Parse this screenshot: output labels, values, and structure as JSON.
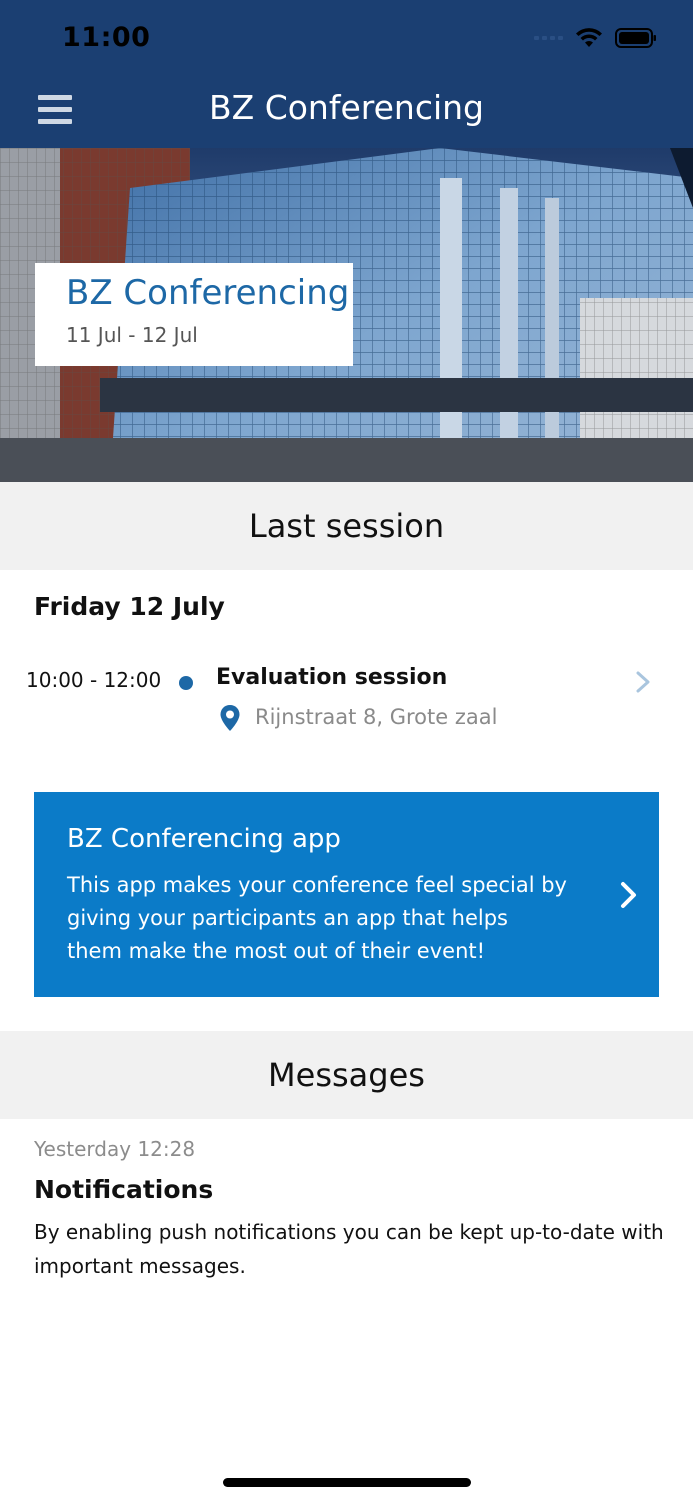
{
  "status_bar": {
    "time": "11:00",
    "icons": [
      "signal-icon",
      "wifi-icon",
      "battery-icon"
    ]
  },
  "nav": {
    "title": "BZ Conferencing",
    "menu_icon": "hamburger-menu-icon"
  },
  "hero": {
    "title": "BZ Conferencing",
    "dates": "11 Jul - 12 Jul"
  },
  "last_session": {
    "header": "Last session",
    "day": "Friday 12 July",
    "session": {
      "time": "10:00 - 12:00",
      "title": "Evaluation session",
      "location": "Rijnstraat 8, Grote zaal"
    }
  },
  "promo": {
    "title": "BZ Conferencing app",
    "text": "This app makes your conference feel special by giving your participants an app that helps them make the most out of their event!"
  },
  "messages": {
    "header": "Messages",
    "items": [
      {
        "time": "Yesterday 12:28",
        "title": "Notifications",
        "body": "By enabling push notifications you can be kept up-to-date with important messages."
      }
    ]
  },
  "colors": {
    "header_bg": "#1b3f72",
    "accent_blue": "#1d68a6",
    "promo_bg": "#0b7bc8",
    "section_bg": "#f1f1f1"
  }
}
